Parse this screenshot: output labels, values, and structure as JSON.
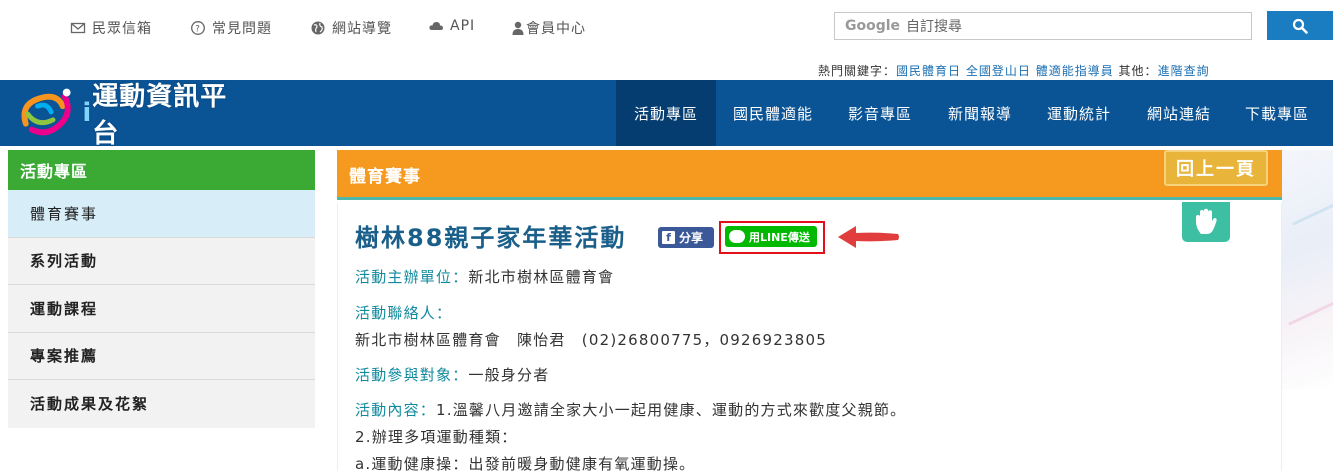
{
  "utility": {
    "mailbox": "民眾信箱",
    "faq": "常見問題",
    "sitemap": "網站導覽",
    "api": "API",
    "member": "會員中心"
  },
  "search": {
    "brand": "Google",
    "placeholder": "自訂搜尋"
  },
  "hot_keywords": {
    "label": "熱門關鍵字：",
    "k1": "國民體育日",
    "k2": "全國登山日",
    "k3": "體適能指導員",
    "other_label": "其他：",
    "advanced": "進階查詢"
  },
  "logo": {
    "text": "運動資訊平台",
    "prefix": "i"
  },
  "nav": {
    "items": [
      {
        "label": "活動專區"
      },
      {
        "label": "國民體適能"
      },
      {
        "label": "影音專區"
      },
      {
        "label": "新聞報導"
      },
      {
        "label": "運動統計"
      },
      {
        "label": "網站連結"
      },
      {
        "label": "下載專區"
      }
    ]
  },
  "sidebar": {
    "title": "活動專區",
    "items": [
      {
        "label": "體育賽事"
      },
      {
        "label": "系列活動"
      },
      {
        "label": "運動課程"
      },
      {
        "label": "專案推薦"
      },
      {
        "label": "活動成果及花絮"
      }
    ]
  },
  "content": {
    "section_title": "體育賽事",
    "back_label": "回上一頁",
    "title": "樹林88親子家年華活動",
    "fb_share": "分享",
    "line_share": "用LINE傳送",
    "organizer_label": "活動主辦單位：",
    "organizer_value": "新北市樹林區體育會",
    "contact_label": "活動聯絡人：",
    "contact_value": "新北市樹林區體育會　陳怡君　(02)26800775，0926923805",
    "audience_label": "活動參與對象：",
    "audience_value": "一般身分者",
    "desc_label": "活動內容：",
    "desc_line1": "1.溫馨八月邀請全家大小一起用健康、運動的方式來歡度父親節。",
    "desc_line2": "2.辦理多項運動種類：",
    "desc_line3": "a.運動健康操：出發前暖身動健康有氧運動操。"
  },
  "colors": {
    "nav_bg": "#0a5496",
    "sidebar_head": "#3aaa35",
    "content_head": "#f59a1f",
    "line_green": "#00b900",
    "highlight_red": "#e3101c"
  }
}
